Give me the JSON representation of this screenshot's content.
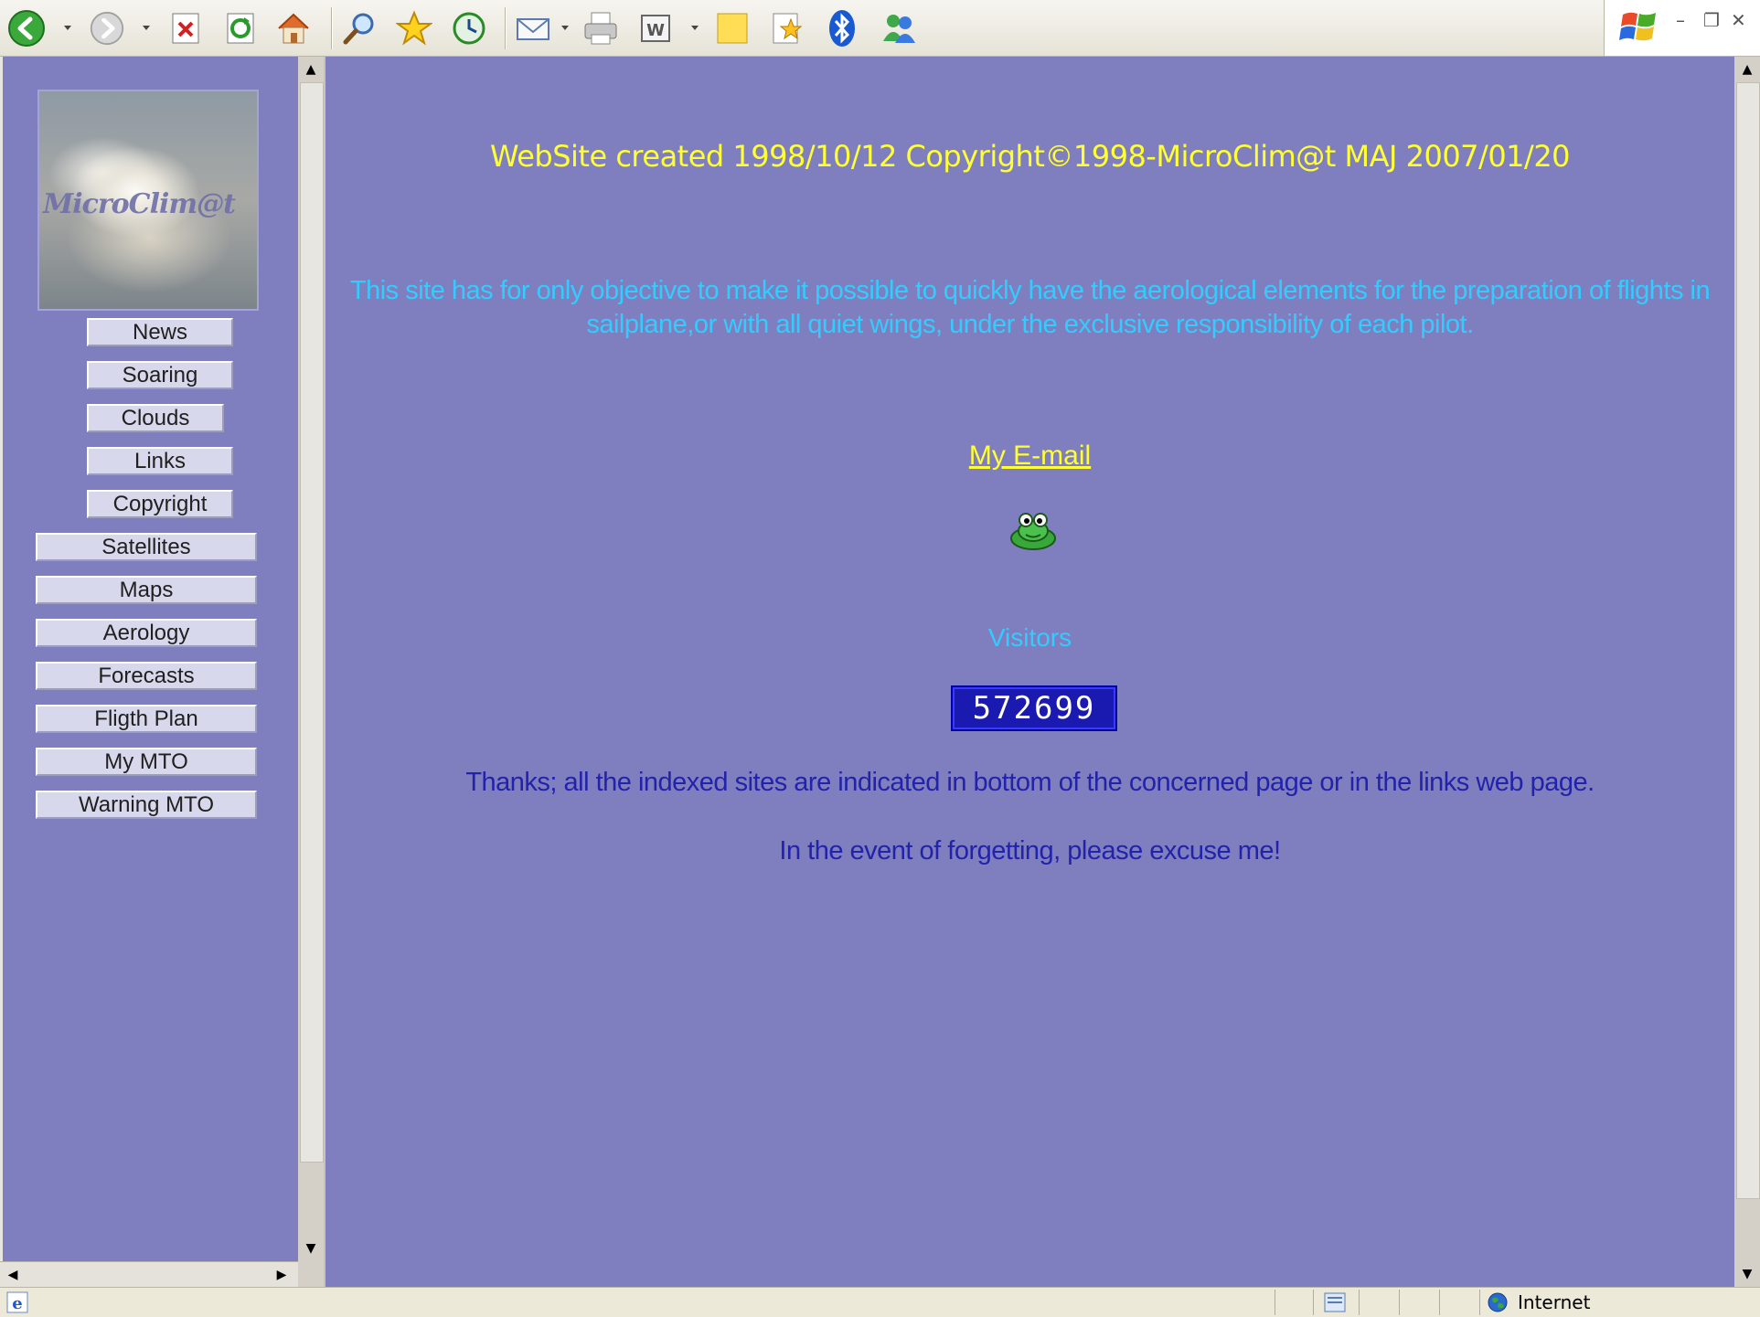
{
  "toolbar": {
    "icons": [
      "back-icon",
      "forward-icon",
      "stop-icon",
      "refresh-icon",
      "home-icon",
      "search-icon",
      "favorites-icon",
      "history-icon",
      "mail-icon",
      "print-icon",
      "edit-word-icon",
      "notes-icon",
      "research-icon",
      "bluetooth-icon",
      "messenger-icon"
    ]
  },
  "nav": {
    "logo_text": "MicroClim@t",
    "items": [
      {
        "label": "News"
      },
      {
        "label": "Soaring"
      },
      {
        "label": "Clouds"
      },
      {
        "label": "Links"
      },
      {
        "label": "Copyright"
      },
      {
        "label": "Satellites"
      },
      {
        "label": "Maps"
      },
      {
        "label": "Aerology"
      },
      {
        "label": "Forecasts"
      },
      {
        "label": "Fligth Plan"
      },
      {
        "label": "My MTO"
      },
      {
        "label": "Warning MTO"
      }
    ]
  },
  "main": {
    "site_info": "WebSite created 1998/10/12 Copyright©1998-MicroClim@t MAJ 2007/01/20",
    "objective": "This site has for only objective to make it possible to quickly have the aerological elements for the preparation of flights in sailplane,or with all quiet wings, under the exclusive responsibility of each pilot.",
    "email_link": "My E-mail",
    "visitors_label": "Visitors",
    "visitor_count": "572699",
    "thanks": "Thanks; all the indexed sites are indicated in bottom of the concerned page or in the links web page.",
    "forget": "In the event of forgetting, please excuse me!"
  },
  "statusbar": {
    "zone": "Internet"
  },
  "colors": {
    "page_bg": "#7f7fbf",
    "yellow": "#ffff33",
    "cyan": "#33ccff",
    "dark_blue": "#2222aa"
  }
}
